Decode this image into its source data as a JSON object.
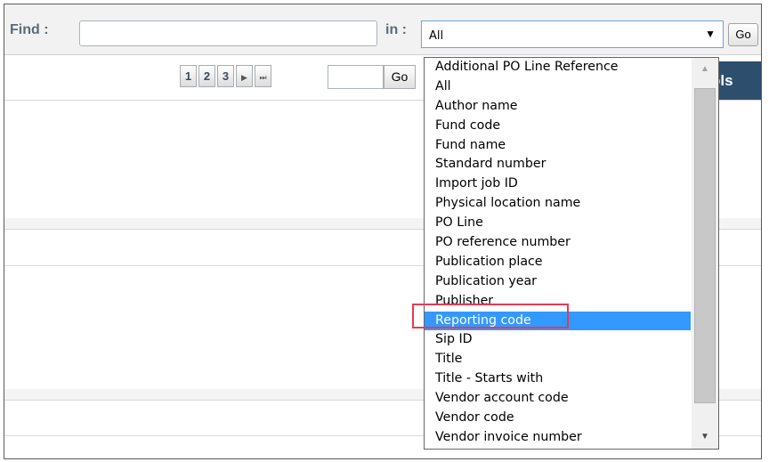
{
  "find": {
    "label": "Find :",
    "value": "",
    "in_label": "in :",
    "selected": "All",
    "arrow_icon": "▼",
    "go_label": "Go"
  },
  "pager": {
    "pages": [
      "1",
      "2",
      "3"
    ],
    "next_icon": "▶",
    "last_icon": "⏭",
    "page_value": "",
    "go_label": "Go"
  },
  "tools_label": "ols",
  "dropdown": {
    "options": [
      "Additional PO Line Reference",
      "All",
      "Author name",
      "Fund code",
      "Fund name",
      "Standard number",
      "Import job ID",
      "Physical location name",
      "PO Line",
      "PO reference number",
      "Publication place",
      "Publication year",
      "Publisher",
      "Reporting code",
      "Sip ID",
      "Title",
      "Title - Starts with",
      "Vendor account code",
      "Vendor code",
      "Vendor invoice number"
    ],
    "selected_index": 13,
    "scroll_up_icon": "▲",
    "scroll_down_icon": "▼"
  },
  "colors": {
    "selected_bg": "#3399ff",
    "highlight_border": "#e23c55",
    "tools_bg": "#2e4e6e"
  }
}
